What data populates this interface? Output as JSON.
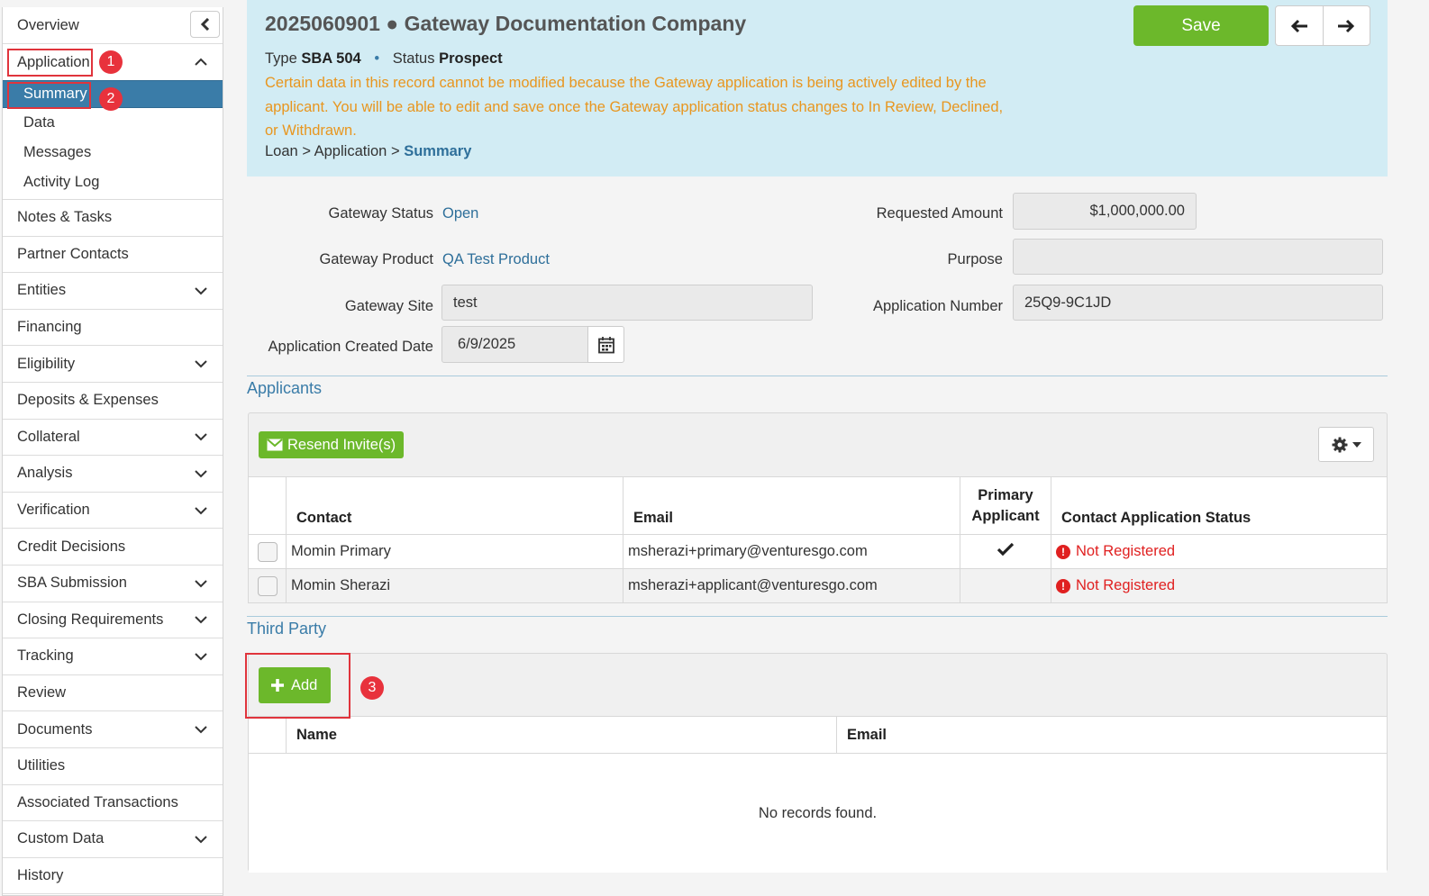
{
  "sidebar": {
    "overview": "Overview",
    "application": "Application",
    "sub_items": [
      "Summary",
      "Data",
      "Messages",
      "Activity Log"
    ],
    "items": [
      {
        "label": "Notes & Tasks",
        "chevron": false
      },
      {
        "label": "Partner Contacts",
        "chevron": false
      },
      {
        "label": "Entities",
        "chevron": true
      },
      {
        "label": "Financing",
        "chevron": false
      },
      {
        "label": "Eligibility",
        "chevron": true
      },
      {
        "label": "Deposits & Expenses",
        "chevron": false
      },
      {
        "label": "Collateral",
        "chevron": true
      },
      {
        "label": "Analysis",
        "chevron": true
      },
      {
        "label": "Verification",
        "chevron": true
      },
      {
        "label": "Credit Decisions",
        "chevron": false
      },
      {
        "label": "SBA Submission",
        "chevron": true
      },
      {
        "label": "Closing Requirements",
        "chevron": true
      },
      {
        "label": "Tracking",
        "chevron": true
      },
      {
        "label": "Review",
        "chevron": false
      },
      {
        "label": "Documents",
        "chevron": true
      },
      {
        "label": "Utilities",
        "chevron": false
      },
      {
        "label": "Associated Transactions",
        "chevron": false
      },
      {
        "label": "Custom Data",
        "chevron": true
      },
      {
        "label": "History",
        "chevron": false
      }
    ]
  },
  "annotations": {
    "one": "1",
    "two": "2",
    "three": "3",
    "color": "#e0343c"
  },
  "header": {
    "title": "2025060901 ● Gateway Documentation Company",
    "type_label": "Type",
    "type_value": "SBA 504",
    "status_label": "Status",
    "status_value": "Prospect",
    "warning": "Certain data in this record cannot be modified because the Gateway application is being actively edited by the applicant. You will be able to edit and save once the Gateway application status changes to In Review, Declined, or Withdrawn.",
    "breadcrumb": [
      "Loan",
      "Application",
      "Summary"
    ],
    "save_label": "Save",
    "background": "#d2ecf4"
  },
  "form": {
    "gateway_status_label": "Gateway Status",
    "gateway_status_value": "Open",
    "gateway_product_label": "Gateway Product",
    "gateway_product_value": "QA Test Product",
    "gateway_site_label": "Gateway Site",
    "gateway_site_value": "test",
    "created_date_label": "Application Created Date",
    "created_date_value": "6/9/2025",
    "requested_amount_label": "Requested Amount",
    "requested_amount_value": "$1,000,000.00",
    "purpose_label": "Purpose",
    "purpose_value": "",
    "app_number_label": "Application Number",
    "app_number_value": "25Q9-9C1JD"
  },
  "applicants": {
    "section_title": "Applicants",
    "resend_label": "Resend Invite(s)",
    "columns": [
      "Contact",
      "Email",
      "Primary Applicant",
      "Contact Application Status"
    ],
    "rows": [
      {
        "contact": "Momin Primary",
        "email": "msherazi+primary@venturesgo.com",
        "primary": true,
        "status": "Not Registered"
      },
      {
        "contact": "Momin Sherazi",
        "email": "msherazi+applicant@venturesgo.com",
        "primary": false,
        "status": "Not Registered"
      }
    ]
  },
  "third_party": {
    "section_title": "Third Party",
    "add_label": "Add",
    "columns": [
      "Name",
      "Email"
    ],
    "empty_message": "No records found."
  },
  "colors": {
    "accent": "#3a7ca8",
    "green": "#6cb82b",
    "warning": "#e8961f",
    "error": "#e02020"
  }
}
